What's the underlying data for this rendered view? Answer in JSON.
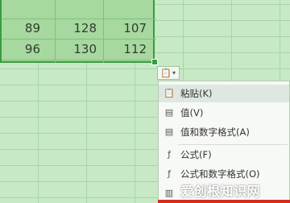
{
  "sheet": {
    "rows": [
      [
        "89",
        "128",
        "107"
      ],
      [
        "96",
        "130",
        "112"
      ]
    ]
  },
  "paste_menu": {
    "items": [
      {
        "label": "粘贴(K)",
        "icon": "paste-icon"
      },
      {
        "label": "值(V)",
        "icon": "values-icon"
      },
      {
        "label": "值和数字格式(A)",
        "icon": "values-number-format-icon"
      },
      {
        "label": "公式(F)",
        "icon": "formula-icon"
      },
      {
        "label": "公式和数字格式(O)",
        "icon": "formula-number-format-icon"
      }
    ]
  },
  "watermark": "爱创根知识网",
  "colors": {
    "accent": "#3a9b3e",
    "highlight_box": "#d9281e"
  }
}
